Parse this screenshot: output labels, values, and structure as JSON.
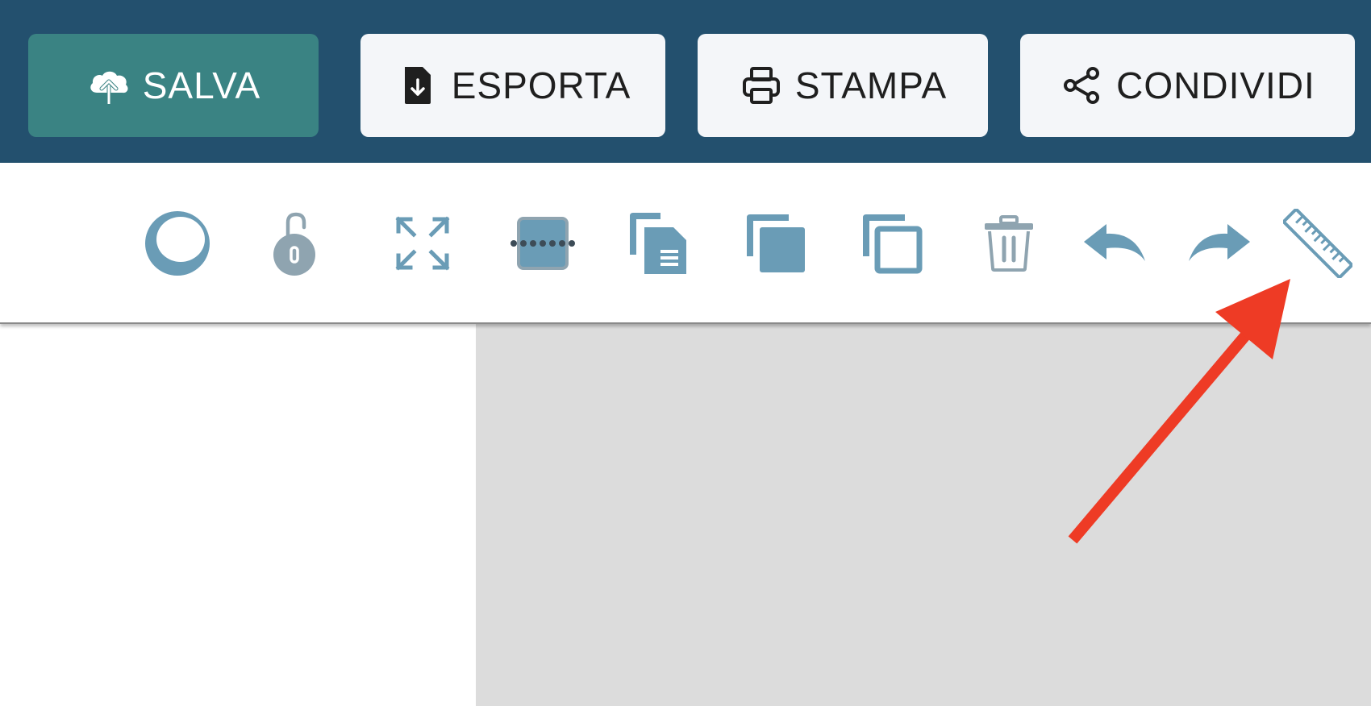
{
  "header": {
    "buttons": [
      {
        "label": "SALVA",
        "icon": "cloud-upload-icon"
      },
      {
        "label": "ESPORTA",
        "icon": "file-download-icon"
      },
      {
        "label": "STAMPA",
        "icon": "printer-icon"
      },
      {
        "label": "CONDIVIDI",
        "icon": "share-icon"
      }
    ]
  },
  "toolbar": {
    "tools": [
      "circle-shape-icon",
      "unlock-icon",
      "expand-icon",
      "align-center-icon",
      "copy-icon",
      "bring-forward-icon",
      "send-backward-icon",
      "trash-icon",
      "undo-icon",
      "redo-icon",
      "ruler-icon"
    ]
  },
  "colors": {
    "header_bg": "#23506e",
    "primary_button": "#3a8383",
    "secondary_button": "#f4f6f9",
    "tool_icon": "#6a9cb6",
    "canvas_bg": "#dcdcdc",
    "annotation_arrow": "#ee3b25"
  }
}
